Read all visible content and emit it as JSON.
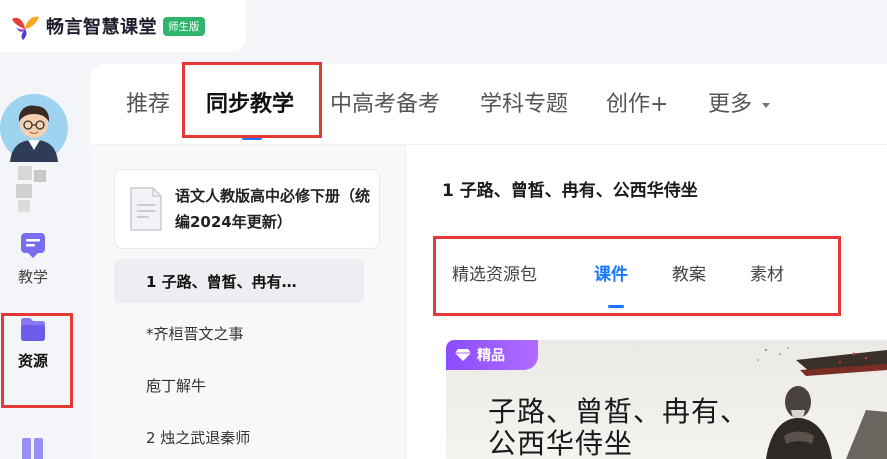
{
  "app": {
    "name": "畅言智慧课堂",
    "edition": "师生版"
  },
  "sidebar": {
    "items": [
      {
        "label": "教学",
        "icon": "teaching-icon"
      },
      {
        "label": "资源",
        "icon": "resource-folder-icon",
        "active": true
      },
      {
        "label": "",
        "icon": "book-icon"
      }
    ]
  },
  "top_tabs": [
    {
      "label": "推荐"
    },
    {
      "label": "同步教学",
      "active": true
    },
    {
      "label": "中高考备考"
    },
    {
      "label": "学科专题"
    },
    {
      "label": "创作+"
    },
    {
      "label": "更多"
    }
  ],
  "book": {
    "title": "语文人教版高中必修下册（统编2024年更新）"
  },
  "lessons": [
    {
      "label": "1 子路、曾皙、冉有…",
      "active": true
    },
    {
      "label": "*齐桓晋文之事"
    },
    {
      "label": "庖丁解牛"
    },
    {
      "label": "2 烛之武退秦师"
    }
  ],
  "content": {
    "title": "1 子路、曾皙、冉有、公西华侍坐"
  },
  "resource_tabs": [
    {
      "label": "精选资源包"
    },
    {
      "label": "课件",
      "active": true
    },
    {
      "label": "教案"
    },
    {
      "label": "素材"
    }
  ],
  "card": {
    "badge": "精品",
    "title": "子路、曾皙、冉有、公西华侍坐"
  },
  "colors": {
    "accent": "#1677ff",
    "highlight_box": "#e53935",
    "premium": "#8a4dff",
    "edition_badge": "#2fb56b"
  }
}
